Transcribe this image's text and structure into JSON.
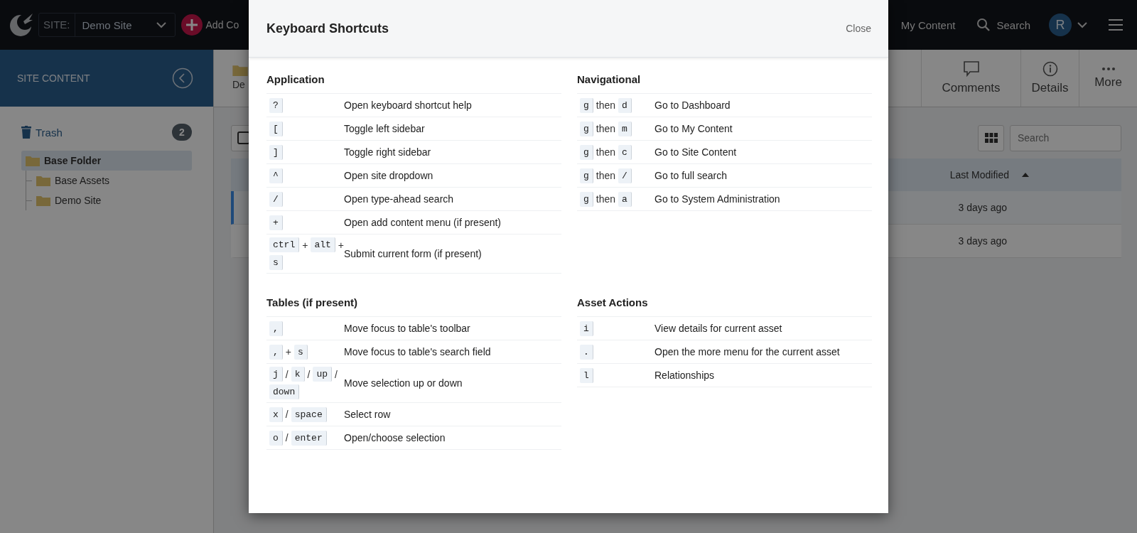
{
  "header": {
    "site_label": "SITE:",
    "site_value": "Demo Site",
    "add_button": "Add Co",
    "nav_link": "My Content",
    "search": "Search",
    "avatar": "R"
  },
  "sidebar": {
    "title": "SITE CONTENT",
    "trash": {
      "label": "Trash",
      "count": "2"
    },
    "tree": [
      {
        "label": "Base Folder",
        "selected": true,
        "children": [
          {
            "label": "Base Assets",
            "selected": false
          },
          {
            "label": "Demo Site",
            "selected": false
          }
        ]
      }
    ]
  },
  "toolbar": {
    "breadcrumb": "De",
    "actions": [
      {
        "kind": "comments",
        "label": "Comments"
      },
      {
        "kind": "details",
        "label": "Details"
      },
      {
        "kind": "more",
        "label": "More"
      }
    ],
    "search_placeholder": "Search"
  },
  "select_all": {
    "checked": false
  },
  "table": {
    "column": "Last Modified",
    "sort_ascending": true,
    "rows": [
      {
        "last_modified": "3 days ago",
        "focused": true
      },
      {
        "last_modified": "3 days ago",
        "focused": false
      }
    ]
  },
  "dialog": {
    "title": "Keyboard Shortcuts",
    "close": "Close",
    "sections": [
      {
        "title": "Application",
        "shortcuts": [
          {
            "keys": [
              {
                "kind": "key",
                "text": "?"
              }
            ],
            "description": "Open keyboard shortcut help"
          },
          {
            "keys": [
              {
                "kind": "key",
                "text": "["
              }
            ],
            "description": "Toggle left sidebar"
          },
          {
            "keys": [
              {
                "kind": "key",
                "text": "]"
              }
            ],
            "description": "Toggle right sidebar"
          },
          {
            "keys": [
              {
                "kind": "key",
                "text": "^"
              }
            ],
            "description": "Open site dropdown"
          },
          {
            "keys": [
              {
                "kind": "key",
                "text": "/"
              }
            ],
            "description": "Open type-ahead search"
          },
          {
            "keys": [
              {
                "kind": "key",
                "text": "+"
              }
            ],
            "description": "Open add content menu (if present)"
          },
          {
            "keys": [
              {
                "kind": "key",
                "text": "ctrl"
              },
              {
                "kind": "word",
                "text": "+"
              },
              {
                "kind": "key",
                "text": "alt"
              },
              {
                "kind": "word",
                "text": "+"
              },
              {
                "kind": "key",
                "text": "s"
              }
            ],
            "description": "Submit current form (if present)"
          }
        ]
      },
      {
        "title": "Navigational",
        "shortcuts": [
          {
            "keys": [
              {
                "kind": "key",
                "text": "g"
              },
              {
                "kind": "word",
                "text": "then"
              },
              {
                "kind": "key",
                "text": "d"
              }
            ],
            "description": "Go to Dashboard"
          },
          {
            "keys": [
              {
                "kind": "key",
                "text": "g"
              },
              {
                "kind": "word",
                "text": "then"
              },
              {
                "kind": "key",
                "text": "m"
              }
            ],
            "description": "Go to My Content"
          },
          {
            "keys": [
              {
                "kind": "key",
                "text": "g"
              },
              {
                "kind": "word",
                "text": "then"
              },
              {
                "kind": "key",
                "text": "c"
              }
            ],
            "description": "Go to Site Content"
          },
          {
            "keys": [
              {
                "kind": "key",
                "text": "g"
              },
              {
                "kind": "word",
                "text": "then"
              },
              {
                "kind": "key",
                "text": "/"
              }
            ],
            "description": "Go to full search"
          },
          {
            "keys": [
              {
                "kind": "key",
                "text": "g"
              },
              {
                "kind": "word",
                "text": "then"
              },
              {
                "kind": "key",
                "text": "a"
              }
            ],
            "description": "Go to System Administration"
          }
        ]
      },
      {
        "title": "Tables (if present)",
        "shortcuts": [
          {
            "keys": [
              {
                "kind": "key",
                "text": ","
              }
            ],
            "description": "Move focus to table's toolbar"
          },
          {
            "keys": [
              {
                "kind": "key",
                "text": ","
              },
              {
                "kind": "word",
                "text": "+"
              },
              {
                "kind": "key",
                "text": "s"
              }
            ],
            "description": "Move focus to table's search field"
          },
          {
            "keys": [
              {
                "kind": "key",
                "text": "j"
              },
              {
                "kind": "word",
                "text": "/"
              },
              {
                "kind": "key",
                "text": "k"
              },
              {
                "kind": "word",
                "text": "/"
              },
              {
                "kind": "key",
                "text": "up"
              },
              {
                "kind": "word",
                "text": "/"
              },
              {
                "kind": "key",
                "text": "down"
              }
            ],
            "description": "Move selection up or down"
          },
          {
            "keys": [
              {
                "kind": "key",
                "text": "x"
              },
              {
                "kind": "word",
                "text": "/"
              },
              {
                "kind": "key",
                "text": "space"
              }
            ],
            "description": "Select row"
          },
          {
            "keys": [
              {
                "kind": "key",
                "text": "o"
              },
              {
                "kind": "word",
                "text": "/"
              },
              {
                "kind": "key",
                "text": "enter"
              }
            ],
            "description": "Open/choose selection"
          }
        ]
      },
      {
        "title": "Asset Actions",
        "shortcuts": [
          {
            "keys": [
              {
                "kind": "key",
                "text": "i"
              }
            ],
            "description": "View details for current asset"
          },
          {
            "keys": [
              {
                "kind": "key",
                "text": "."
              }
            ],
            "description": "Open the more menu for the current asset"
          },
          {
            "keys": [
              {
                "kind": "key",
                "text": "l"
              }
            ],
            "description": "Relationships"
          }
        ]
      }
    ]
  }
}
